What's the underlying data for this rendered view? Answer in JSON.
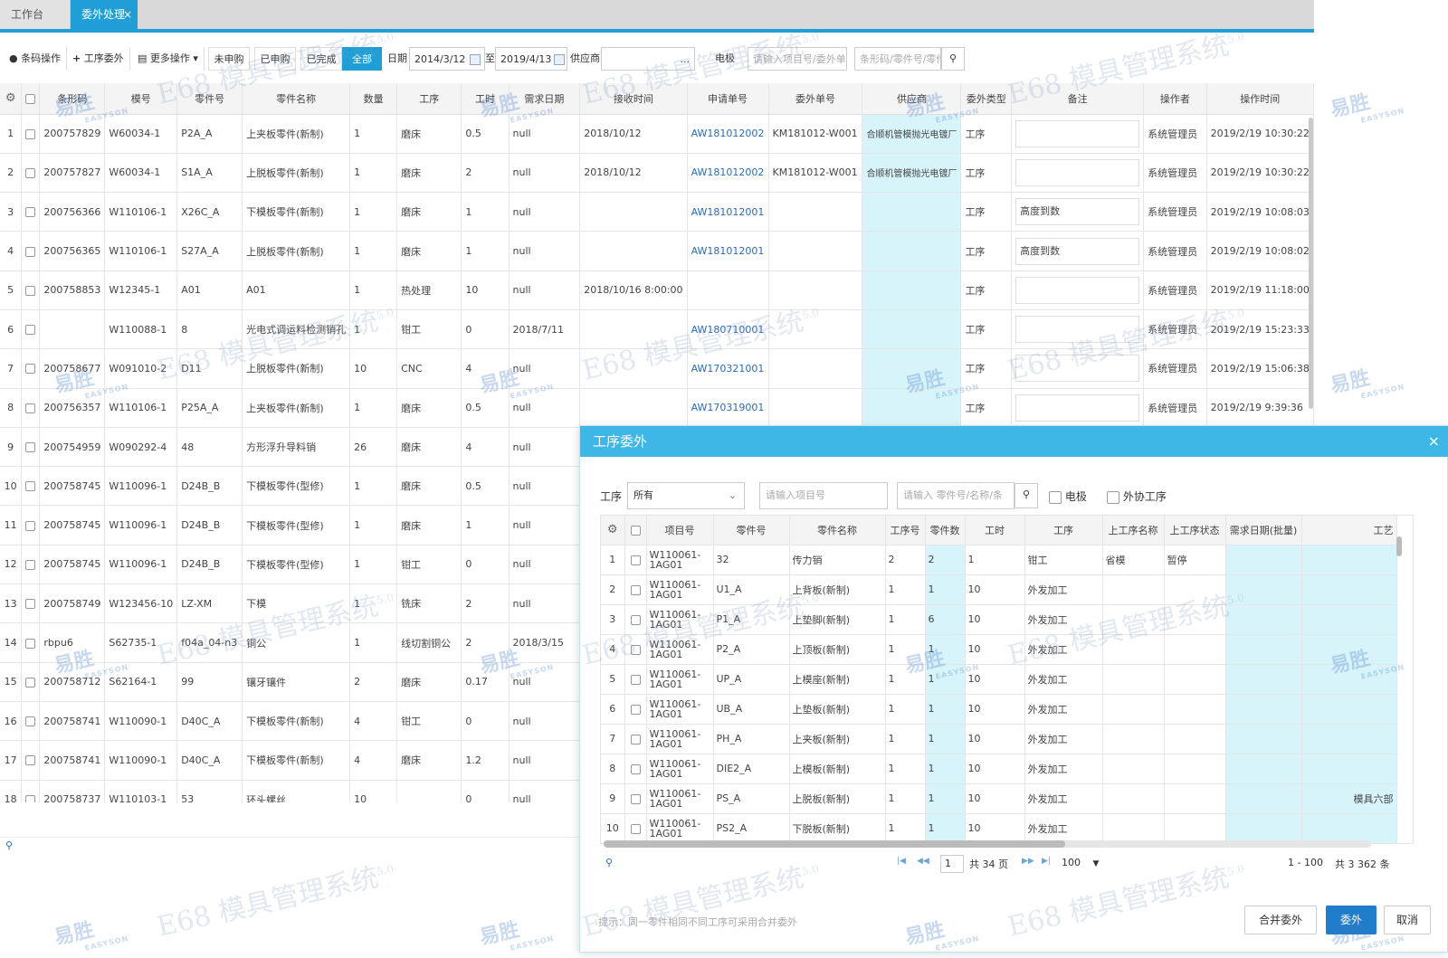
{
  "tabs": {
    "workbench": "工作台",
    "outsource": "委外处理",
    "close": "×"
  },
  "toolbar": {
    "barcode_op": "条码操作",
    "process_outsource": "工序委外",
    "more_ops": "更多操作",
    "filters": [
      "未申购",
      "已申购",
      "已完成",
      "全部"
    ],
    "active_filter": "全部",
    "date_label": "日期",
    "date_from": "2014/3/12",
    "date_to_label": "至",
    "date_to": "2019/4/13",
    "supplier_label": "供应商",
    "supplier_more": "...",
    "electrode_label": "电极",
    "search1_placeholder": "请输入项目号/委外单号",
    "search2_placeholder": "条形码/零件号/零件"
  },
  "main_grid": {
    "columns": [
      "",
      "",
      "条形码",
      "模号",
      "零件号",
      "零件名称",
      "数量",
      "工序",
      "工时",
      "需求日期",
      "接收时间",
      "申请单号",
      "委外单号",
      "供应商",
      "委外类型",
      "备注",
      "操作者",
      "操作时间"
    ],
    "rows": [
      [
        "1",
        "200757829",
        "W60034-1",
        "P2A_A",
        "上夹板零件(新制)",
        "1",
        "磨床",
        "0.5",
        "null",
        "2018/10/12",
        "AW181012002",
        "KM181012-W001",
        "合顺机管模抛光电镀厂",
        "工序",
        "",
        "系统管理员",
        "2019/2/19 10:30:22"
      ],
      [
        "2",
        "200757827",
        "W60034-1",
        "S1A_A",
        "上脱板零件(新制)",
        "1",
        "磨床",
        "2",
        "null",
        "2018/10/12",
        "AW181012002",
        "KM181012-W001",
        "合顺机管模抛光电镀厂",
        "工序",
        "",
        "系统管理员",
        "2019/2/19 10:30:22"
      ],
      [
        "3",
        "200756366",
        "W110106-1",
        "X26C_A",
        "下模板零件(新制)",
        "1",
        "磨床",
        "1",
        "null",
        "",
        "AW181012001",
        "",
        "",
        "工序",
        "高度到数",
        "系统管理员",
        "2019/2/19 10:08:03"
      ],
      [
        "4",
        "200756365",
        "W110106-1",
        "S27A_A",
        "上脱板零件(新制)",
        "1",
        "磨床",
        "1",
        "null",
        "",
        "AW181012001",
        "",
        "",
        "工序",
        "高度到数",
        "系统管理员",
        "2019/2/19 10:08:02"
      ],
      [
        "5",
        "200758853",
        "W12345-1",
        "A01",
        "A01",
        "1",
        "热处理",
        "10",
        "null",
        "2018/10/16 8:00:00",
        "",
        "",
        "",
        "工序",
        "",
        "系统管理员",
        "2019/2/19 11:18:00"
      ],
      [
        "6",
        "",
        "W110088-1",
        "8",
        "光电式调运料检测销孔",
        "1",
        "钳工",
        "0",
        "2018/7/11",
        "",
        "AW180710001",
        "",
        "",
        "工序",
        "",
        "系统管理员",
        "2019/2/19 15:23:33"
      ],
      [
        "7",
        "200758677",
        "W091010-2",
        "D11",
        "上脱板零件(新制)",
        "10",
        "CNC",
        "4",
        "null",
        "",
        "AW170321001",
        "",
        "",
        "工序",
        "",
        "系统管理员",
        "2019/2/19 15:06:38"
      ],
      [
        "8",
        "200756357",
        "W110106-1",
        "P25A_A",
        "上夹板零件(新制)",
        "1",
        "磨床",
        "0.5",
        "null",
        "",
        "AW170319001",
        "",
        "",
        "工序",
        "",
        "系统管理员",
        "2019/2/19 9:39:36"
      ],
      [
        "9",
        "200754959",
        "W090292-4",
        "48",
        "方形浮升导料销",
        "26",
        "磨床",
        "4",
        "null",
        "",
        "",
        "",
        "",
        "",
        "",
        "",
        ""
      ],
      [
        "10",
        "200758745",
        "W110096-1",
        "D24B_B",
        "下模板零件(型修)",
        "1",
        "磨床",
        "0.5",
        "null",
        "",
        "",
        "",
        "",
        "",
        "",
        "",
        ""
      ],
      [
        "11",
        "200758745",
        "W110096-1",
        "D24B_B",
        "下模板零件(型修)",
        "1",
        "磨床",
        "1",
        "null",
        "",
        "",
        "",
        "",
        "",
        "",
        "",
        ""
      ],
      [
        "12",
        "200758745",
        "W110096-1",
        "D24B_B",
        "下模板零件(型修)",
        "1",
        "钳工",
        "0",
        "null",
        "",
        "",
        "",
        "",
        "",
        "",
        "",
        ""
      ],
      [
        "13",
        "200758749",
        "W123456-10",
        "LZ-XM",
        "下模",
        "1",
        "铣床",
        "2",
        "null",
        "",
        "",
        "",
        "",
        "",
        "",
        "",
        ""
      ],
      [
        "14",
        "rbpu6",
        "S62735-1",
        "f04a_04-n3",
        "铜公",
        "1",
        "线切割铜公",
        "2",
        "2018/3/15",
        "",
        "",
        "",
        "",
        "",
        "",
        "",
        ""
      ],
      [
        "15",
        "200758712",
        "S62164-1",
        "99",
        "镶牙镶件",
        "2",
        "磨床",
        "0.17",
        "null",
        "",
        "",
        "",
        "",
        "",
        "",
        "",
        ""
      ],
      [
        "16",
        "200758741",
        "W110090-1",
        "D40C_A",
        "下模板零件(新制)",
        "4",
        "钳工",
        "0",
        "null",
        "",
        "",
        "",
        "",
        "",
        "",
        "",
        ""
      ],
      [
        "17",
        "200758741",
        "W110090-1",
        "D40C_A",
        "下模板零件(新制)",
        "4",
        "磨床",
        "1.2",
        "null",
        "",
        "",
        "",
        "",
        "",
        "",
        "",
        ""
      ],
      [
        "18",
        "200758737",
        "W110103-1",
        "53",
        "环头螺丝",
        "10",
        "",
        "0",
        "null",
        "",
        "",
        "",
        "",
        "",
        "",
        "",
        ""
      ]
    ]
  },
  "dialog": {
    "title": "工序委外",
    "close": "×",
    "process_label": "工序",
    "process_value": "所有",
    "project_placeholder": "请输入项目号",
    "part_placeholder": "请输入 零件号/名称/条",
    "electrode_label": "电极",
    "external_label": "外协工序",
    "columns": [
      "",
      "",
      "项目号",
      "零件号",
      "零件名称",
      "工序号",
      "零件数",
      "工时",
      "工序",
      "上工序名称",
      "上工序状态",
      "需求日期(批量)",
      "工艺"
    ],
    "rows": [
      [
        "1",
        "W110061-1AG01",
        "32",
        "传力销",
        "2",
        "2",
        "1",
        "钳工",
        "省模",
        "暂停",
        "",
        ""
      ],
      [
        "2",
        "W110061-1AG01",
        "U1_A",
        "上背板(新制)",
        "1",
        "1",
        "10",
        "外发加工",
        "",
        "",
        "",
        ""
      ],
      [
        "3",
        "W110061-1AG01",
        "P1_A",
        "上垫脚(新制)",
        "1",
        "6",
        "10",
        "外发加工",
        "",
        "",
        "",
        ""
      ],
      [
        "4",
        "W110061-1AG01",
        "P2_A",
        "上顶板(新制)",
        "1",
        "1",
        "10",
        "外发加工",
        "",
        "",
        "",
        ""
      ],
      [
        "5",
        "W110061-1AG01",
        "UP_A",
        "上模座(新制)",
        "1",
        "1",
        "10",
        "外发加工",
        "",
        "",
        "",
        ""
      ],
      [
        "6",
        "W110061-1AG01",
        "UB_A",
        "上垫板(新制)",
        "1",
        "1",
        "10",
        "外发加工",
        "",
        "",
        "",
        ""
      ],
      [
        "7",
        "W110061-1AG01",
        "PH_A",
        "上夹板(新制)",
        "1",
        "1",
        "10",
        "外发加工",
        "",
        "",
        "",
        ""
      ],
      [
        "8",
        "W110061-1AG01",
        "DIE2_A",
        "上模板(新制)",
        "1",
        "1",
        "10",
        "外发加工",
        "",
        "",
        "",
        ""
      ],
      [
        "9",
        "W110061-1AG01",
        "PS_A",
        "上脱板(新制)",
        "1",
        "1",
        "10",
        "外发加工",
        "",
        "",
        "",
        "模具六部"
      ],
      [
        "10",
        "W110061-1AG01",
        "PS2_A",
        "下脱板(新制)",
        "1",
        "1",
        "10",
        "外发加工",
        "",
        "",
        "",
        ""
      ]
    ],
    "pager": {
      "page": "1",
      "total_pages": "共 34 页",
      "page_size": "100",
      "range": "1 - 100",
      "total": "共 3 362 条"
    },
    "hint": "提示：同一零件相同不同工序可采用合并委外",
    "buttons": {
      "merge": "合并委外",
      "outsource": "委外",
      "cancel": "取消"
    }
  },
  "watermark": {
    "text": "E68 模具管理系统",
    "version": "5.0",
    "brand": "易胜",
    "brand_en": "EASYSON"
  }
}
